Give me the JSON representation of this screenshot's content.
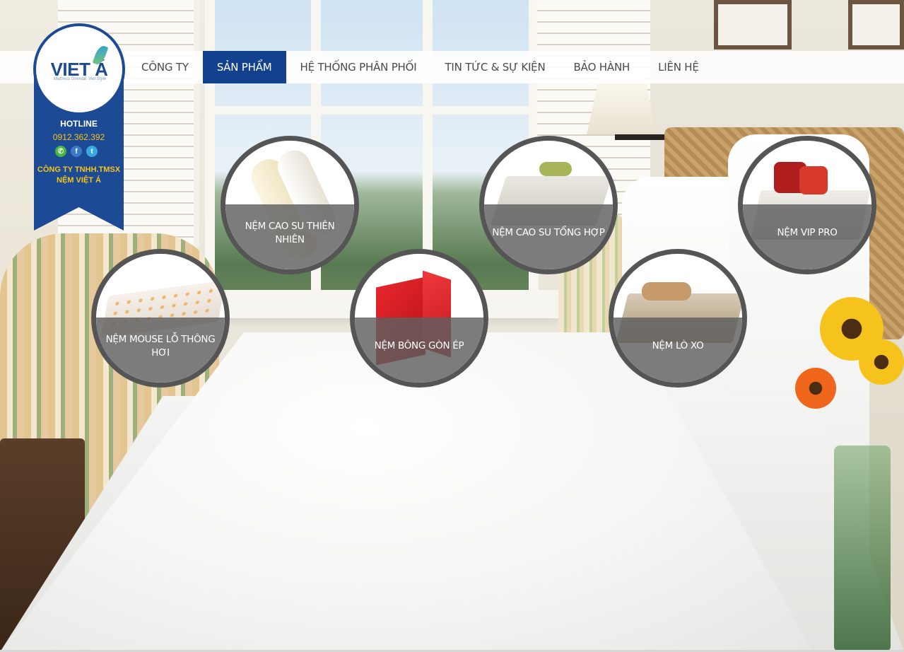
{
  "brand": {
    "logo_text": "VIET Á",
    "tagline": "Mattress Oriental, Viet Style",
    "hotline_label": "HOTLINE",
    "hotline_number": "0912.362.392",
    "company_name": "CÔNG TY TNHH.TMSX NỆM VIỆT Á",
    "colors": {
      "primary": "#12428f",
      "accent": "#f5c518"
    },
    "social_icons": [
      "phone-icon",
      "facebook-icon",
      "twitter-icon"
    ]
  },
  "nav": {
    "items": [
      {
        "label": "CÔNG TY",
        "active": false
      },
      {
        "label": "SẢN PHẨM",
        "active": true
      },
      {
        "label": "HỆ THỐNG PHÂN PHỐI",
        "active": false
      },
      {
        "label": "TIN TỨC & SỰ KIỆN",
        "active": false
      },
      {
        "label": "BẢO HÀNH",
        "active": false
      },
      {
        "label": "LIÊN HỆ",
        "active": false
      }
    ]
  },
  "products": [
    {
      "label": "NỆM CAO SU THIÊN NHIÊN"
    },
    {
      "label": "NỆM CAO SU TỔNG HỢP"
    },
    {
      "label": "NỆM VIP PRO"
    },
    {
      "label": "NỆM MOUSE LỖ THÔNG HƠI"
    },
    {
      "label": "NỆM BÔNG GÒN ÉP"
    },
    {
      "label": "NỆM LÒ XO"
    }
  ]
}
